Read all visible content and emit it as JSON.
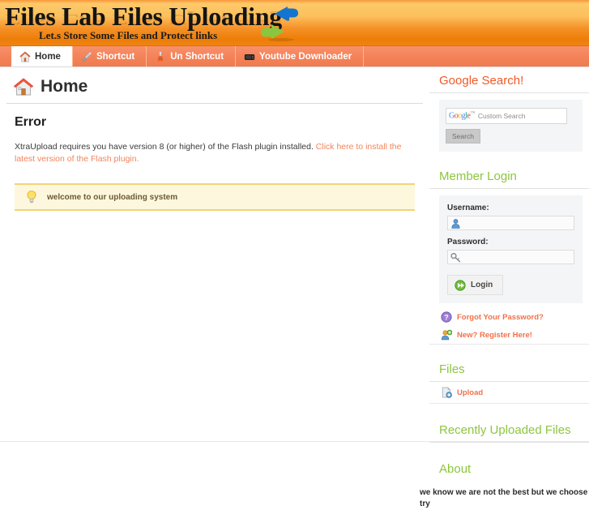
{
  "header": {
    "site_title": "Files Lab Files Uploading",
    "tagline": "Let.s Store Some Files and Protect links",
    "logo_icon": "sync-arrows-icon",
    "colors": {
      "gradient_top": "#fdc96a",
      "gradient_bottom": "#ee7d08",
      "tabbar": "#f4835a"
    }
  },
  "tabs": [
    {
      "label": "Home",
      "icon": "house-icon",
      "active": true
    },
    {
      "label": "Shortcut",
      "icon": "screwdriver-icon",
      "active": false
    },
    {
      "label": "Un Shortcut",
      "icon": "broom-icon",
      "active": false
    },
    {
      "label": "Youtube Downloader",
      "icon": "tv-icon",
      "active": false
    }
  ],
  "content": {
    "page_title": "Home",
    "page_icon": "house-icon",
    "error_heading": "Error",
    "error_text": "XtraUpload requires you have version 8 (or higher) of the Flash plugin installed. ",
    "error_link": "Click here to install the latest version of the Flash plugin.",
    "notice_icon": "lightbulb-icon",
    "notice_text": "welcome to our uploading system"
  },
  "sidebar": {
    "google_search": {
      "title": "Google Search!",
      "title_color": "#f05a28",
      "logo_letters": [
        "G",
        "o",
        "o",
        "g",
        "l",
        "e"
      ],
      "logo_tm": "™",
      "placeholder": "Custom Search",
      "input_value": "",
      "button_label": "Search"
    },
    "member_login": {
      "title": "Member Login",
      "title_color": "#8cc63e",
      "username_label": "Username:",
      "username_value": "",
      "username_icon": "user-icon",
      "password_label": "Password:",
      "password_value": "",
      "password_icon": "key-icon",
      "login_button": "Login",
      "login_icon": "green-arrow-icon",
      "forgot_link": "Forgot Your Password?",
      "forgot_icon": "question-icon",
      "register_link": "New? Register Here!",
      "register_icon": "add-user-icon"
    },
    "files": {
      "title": "Files",
      "upload_label": "Upload",
      "upload_icon": "upload-file-icon"
    },
    "recent": {
      "title": "Recently Uploaded Files"
    },
    "about": {
      "title": "About",
      "line1": "we know we are not the best but we choose to",
      "line2": "try"
    }
  }
}
